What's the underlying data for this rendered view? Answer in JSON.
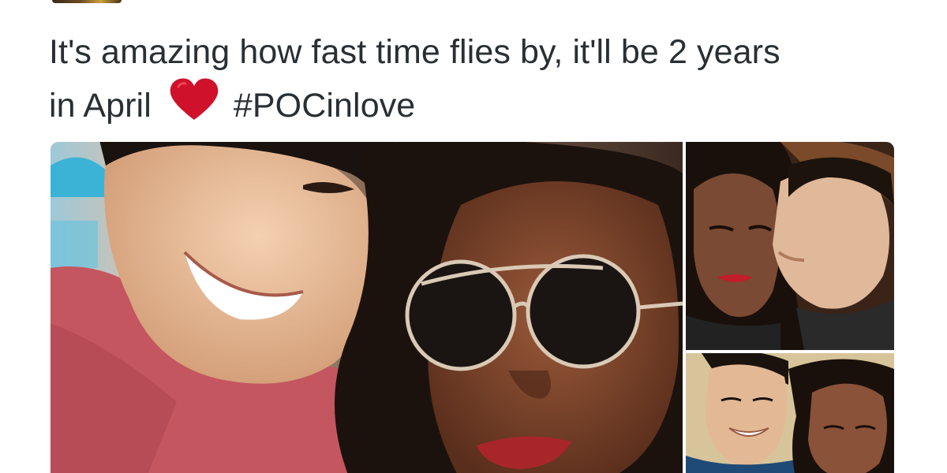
{
  "tweet": {
    "text_line1": "It's amazing how fast time flies by, it'll be 2 years",
    "text_line2_start": "in April",
    "emoji": "red-heart-icon",
    "hashtag": "#POCinlove"
  },
  "colors": {
    "text": "#292f33",
    "heart": "#d0112b",
    "background": "#ffffff"
  },
  "media": {
    "photos": [
      {
        "name": "couple-selfie-sunglasses"
      },
      {
        "name": "couple-kiss-on-cheek"
      },
      {
        "name": "couple-smiling-selfie"
      }
    ]
  }
}
